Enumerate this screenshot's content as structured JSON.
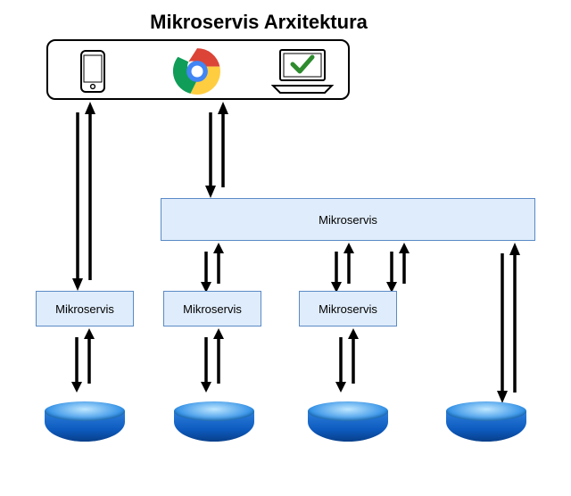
{
  "title": "Mikroservis Arxitektura",
  "client_box": {
    "icons": [
      "phone-icon",
      "chrome-icon",
      "laptop-check-icon"
    ]
  },
  "gateway": {
    "label": "Mikroservis"
  },
  "services": [
    {
      "label": "Mikroservis"
    },
    {
      "label": "Mikroservis"
    },
    {
      "label": "Mikroservis"
    }
  ],
  "db_count": 4
}
